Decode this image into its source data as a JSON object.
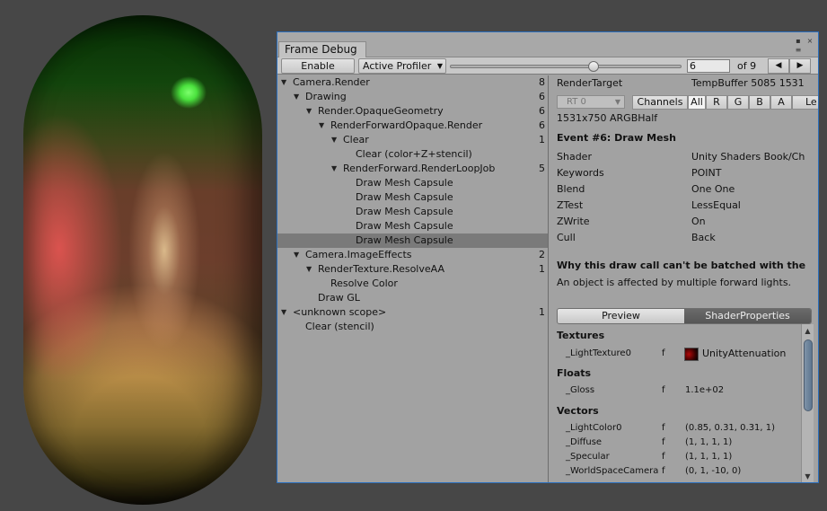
{
  "window": {
    "title": "Frame Debug"
  },
  "toolbar": {
    "enable_label": "Enable",
    "profiler_label": "Active Profiler",
    "step_value": "6",
    "of_label": "of 9",
    "prev_icon": "triangle-left-icon",
    "next_icon": "triangle-right-icon",
    "slider": {
      "value": 6,
      "max": 9
    }
  },
  "tree": {
    "rows": [
      {
        "label": "Camera.Render",
        "count": "8",
        "depth": 0,
        "expanded": true
      },
      {
        "label": "Drawing",
        "count": "6",
        "depth": 1,
        "expanded": true
      },
      {
        "label": "Render.OpaqueGeometry",
        "count": "6",
        "depth": 2,
        "expanded": true
      },
      {
        "label": "RenderForwardOpaque.Render",
        "count": "6",
        "depth": 3,
        "expanded": true
      },
      {
        "label": "Clear",
        "count": "1",
        "depth": 4,
        "expanded": true
      },
      {
        "label": "Clear (color+Z+stencil)",
        "count": "",
        "depth": 5,
        "expanded": null
      },
      {
        "label": "RenderForward.RenderLoopJob",
        "count": "5",
        "depth": 4,
        "expanded": true
      },
      {
        "label": "Draw Mesh Capsule",
        "count": "",
        "depth": 5,
        "expanded": null
      },
      {
        "label": "Draw Mesh Capsule",
        "count": "",
        "depth": 5,
        "expanded": null
      },
      {
        "label": "Draw Mesh Capsule",
        "count": "",
        "depth": 5,
        "expanded": null
      },
      {
        "label": "Draw Mesh Capsule",
        "count": "",
        "depth": 5,
        "expanded": null
      },
      {
        "label": "Draw Mesh Capsule",
        "count": "",
        "depth": 5,
        "expanded": null,
        "selected": true
      },
      {
        "label": "Camera.ImageEffects",
        "count": "2",
        "depth": 1,
        "expanded": true
      },
      {
        "label": "RenderTexture.ResolveAA",
        "count": "1",
        "depth": 2,
        "expanded": true
      },
      {
        "label": "Resolve Color",
        "count": "",
        "depth": 3,
        "expanded": null
      },
      {
        "label": "Draw GL",
        "count": "",
        "depth": 2,
        "expanded": null
      },
      {
        "label": "<unknown scope>",
        "count": "1",
        "depth": 0,
        "expanded": true
      },
      {
        "label": "Clear (stencil)",
        "count": "",
        "depth": 1,
        "expanded": null
      }
    ]
  },
  "detail": {
    "render_target_label": "RenderTarget",
    "render_target_value": "TempBuffer 5085 1531",
    "rt_select": "RT 0",
    "channels_label": "Channels",
    "channels": [
      "All",
      "R",
      "G",
      "B",
      "A"
    ],
    "levels_label": "Le",
    "resolution": "1531x750 ARGBHalf",
    "event_title": "Event #6: Draw Mesh",
    "props": [
      {
        "k": "Shader",
        "v": "Unity Shaders Book/Ch"
      },
      {
        "k": "Keywords",
        "v": "POINT"
      },
      {
        "k": "Blend",
        "v": "One One"
      },
      {
        "k": "ZTest",
        "v": "LessEqual"
      },
      {
        "k": "ZWrite",
        "v": "On"
      },
      {
        "k": "Cull",
        "v": "Back"
      }
    ],
    "batch_title": "Why this draw call can't be batched with the",
    "batch_reason": "An object is affected by multiple forward lights.",
    "tab_preview": "Preview",
    "tab_shader_props": "ShaderProperties",
    "textures_title": "Textures",
    "textures": [
      {
        "name": "_LightTexture0",
        "flag": "f",
        "value": "UnityAttenuation"
      }
    ],
    "floats_title": "Floats",
    "floats": [
      {
        "name": "_Gloss",
        "flag": "f",
        "value": "1.1e+02"
      }
    ],
    "vectors_title": "Vectors",
    "vectors": [
      {
        "name": "_LightColor0",
        "flag": "f",
        "value": "(0.85, 0.31, 0.31, 1)"
      },
      {
        "name": "_Diffuse",
        "flag": "f",
        "value": "(1, 1, 1, 1)"
      },
      {
        "name": "_Specular",
        "flag": "f",
        "value": "(1, 1, 1, 1)"
      },
      {
        "name": "_WorldSpaceCamera",
        "flag": "f",
        "value": "(0, 1, -10, 0)"
      }
    ]
  }
}
